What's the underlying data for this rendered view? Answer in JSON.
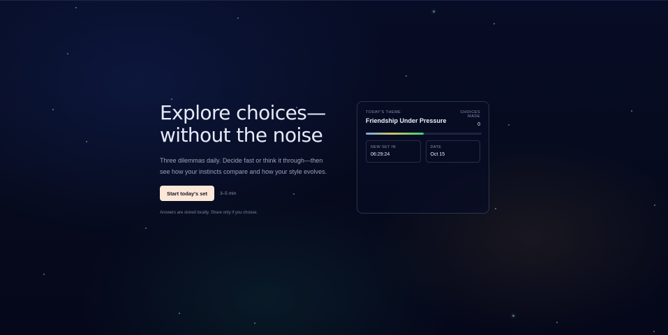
{
  "hero": {
    "headline_line1": "Explore choices—",
    "headline_line2": "without the noise",
    "subtext": "Three dilemmas daily. Decide fast or think it through—then see how your instincts compare and how your style evolves.",
    "cta_label": "Start today's set",
    "duration": "3–5 min",
    "footnote": "Answers are stored locally. Share only if you choose."
  },
  "card": {
    "theme_label": "TODAY'S THEME",
    "theme_name": "Friendship Under Pressure",
    "choices_label": "CHOICES MADE",
    "choices_count": "0",
    "progress_fraction": 0.5,
    "next_set_label": "NEW SET IN",
    "next_set_value": "06:29:24",
    "date_label": "DATE",
    "date_value": "Oct 15"
  },
  "colors": {
    "background": "#060a1c",
    "cta_background": "#fbe7d8",
    "progress_gradient": [
      "#7fa4e8",
      "#c9c560",
      "#3fcf7a"
    ]
  }
}
